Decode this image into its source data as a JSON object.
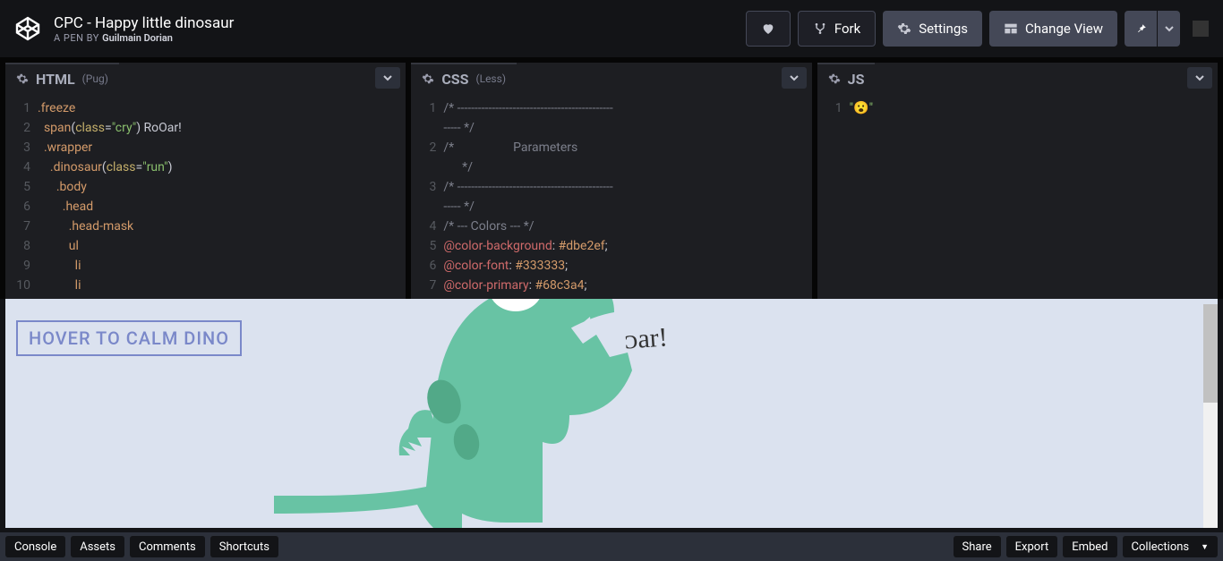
{
  "header": {
    "title": "CPC - Happy little dinosaur",
    "byline_prefix": "A PEN BY ",
    "author": "Guilmain Dorian",
    "fork": "Fork",
    "settings": "Settings",
    "change_view": "Change View"
  },
  "editors": {
    "html": {
      "name": "HTML",
      "sub": "(Pug)",
      "gutter": [
        "1",
        "2",
        "3",
        "4",
        "5",
        "6",
        "7",
        "8",
        "9",
        "10"
      ],
      "lines": [
        {
          "indent": 0,
          "tokens": [
            {
              "c": "tk-tag",
              "t": ".freeze"
            }
          ]
        },
        {
          "indent": 1,
          "tokens": [
            {
              "c": "tk-tag",
              "t": "span"
            },
            {
              "c": "tk-punc",
              "t": "("
            },
            {
              "c": "tk-attr",
              "t": "class"
            },
            {
              "c": "tk-punc",
              "t": "="
            },
            {
              "c": "tk-str",
              "t": "\"cry\""
            },
            {
              "c": "tk-punc",
              "t": ") "
            },
            {
              "c": "",
              "t": "RoOar!"
            }
          ]
        },
        {
          "indent": 1,
          "tokens": [
            {
              "c": "tk-tag",
              "t": ".wrapper"
            }
          ]
        },
        {
          "indent": 2,
          "tokens": [
            {
              "c": "tk-tag",
              "t": ".dinosaur"
            },
            {
              "c": "tk-punc",
              "t": "("
            },
            {
              "c": "tk-attr",
              "t": "class"
            },
            {
              "c": "tk-punc",
              "t": "="
            },
            {
              "c": "tk-str",
              "t": "\"run\""
            },
            {
              "c": "tk-punc",
              "t": ")"
            }
          ]
        },
        {
          "indent": 3,
          "tokens": [
            {
              "c": "tk-tag",
              "t": ".body"
            }
          ]
        },
        {
          "indent": 4,
          "tokens": [
            {
              "c": "tk-tag",
              "t": ".head"
            }
          ]
        },
        {
          "indent": 5,
          "tokens": [
            {
              "c": "tk-tag",
              "t": ".head-mask"
            }
          ]
        },
        {
          "indent": 5,
          "tokens": [
            {
              "c": "tk-tag",
              "t": "ul"
            }
          ]
        },
        {
          "indent": 6,
          "tokens": [
            {
              "c": "tk-tag",
              "t": "li"
            }
          ]
        },
        {
          "indent": 6,
          "tokens": [
            {
              "c": "tk-tag",
              "t": "li"
            }
          ]
        }
      ]
    },
    "css": {
      "name": "CSS",
      "sub": "(Less)",
      "gutter": [
        "1",
        "",
        "2",
        "",
        "3",
        "",
        "4",
        "5",
        "6",
        "7"
      ],
      "lines": [
        {
          "tokens": [
            {
              "c": "tk-cm",
              "t": "/* ---------------------------------------------"
            }
          ]
        },
        {
          "tokens": [
            {
              "c": "tk-cm",
              "t": "----- */"
            }
          ]
        },
        {
          "tokens": [
            {
              "c": "tk-cm",
              "t": "/*                   Parameters                  "
            }
          ]
        },
        {
          "tokens": [
            {
              "c": "tk-cm",
              "t": "      */"
            }
          ]
        },
        {
          "tokens": [
            {
              "c": "tk-cm",
              "t": "/* ---------------------------------------------"
            }
          ]
        },
        {
          "tokens": [
            {
              "c": "tk-cm",
              "t": "----- */"
            }
          ]
        },
        {
          "tokens": [
            {
              "c": "tk-cm",
              "t": "/* --- Colors --- */"
            }
          ]
        },
        {
          "tokens": [
            {
              "c": "tk-var",
              "t": "@color-background"
            },
            {
              "c": "tk-punc",
              "t": ": "
            },
            {
              "c": "tk-num",
              "t": "#dbe2ef"
            },
            {
              "c": "tk-punc",
              "t": ";"
            }
          ]
        },
        {
          "tokens": [
            {
              "c": "tk-var",
              "t": "@color-font"
            },
            {
              "c": "tk-punc",
              "t": ": "
            },
            {
              "c": "tk-num",
              "t": "#333333"
            },
            {
              "c": "tk-punc",
              "t": ";"
            }
          ]
        },
        {
          "tokens": [
            {
              "c": "tk-var",
              "t": "@color-primary"
            },
            {
              "c": "tk-punc",
              "t": ": "
            },
            {
              "c": "tk-num",
              "t": "#68c3a4"
            },
            {
              "c": "tk-punc",
              "t": ";"
            }
          ]
        }
      ]
    },
    "js": {
      "name": "JS",
      "gutter": [
        "1"
      ],
      "lines": [
        {
          "tokens": [
            {
              "c": "tk-str",
              "t": "\"😮\""
            }
          ]
        }
      ]
    }
  },
  "preview": {
    "hover_label": "HOVER TO CALM DINO",
    "cry_text": "ᴐar!"
  },
  "footer": {
    "console": "Console",
    "assets": "Assets",
    "comments": "Comments",
    "shortcuts": "Shortcuts",
    "share": "Share",
    "export": "Export",
    "embed": "Embed",
    "collections": "Collections"
  }
}
